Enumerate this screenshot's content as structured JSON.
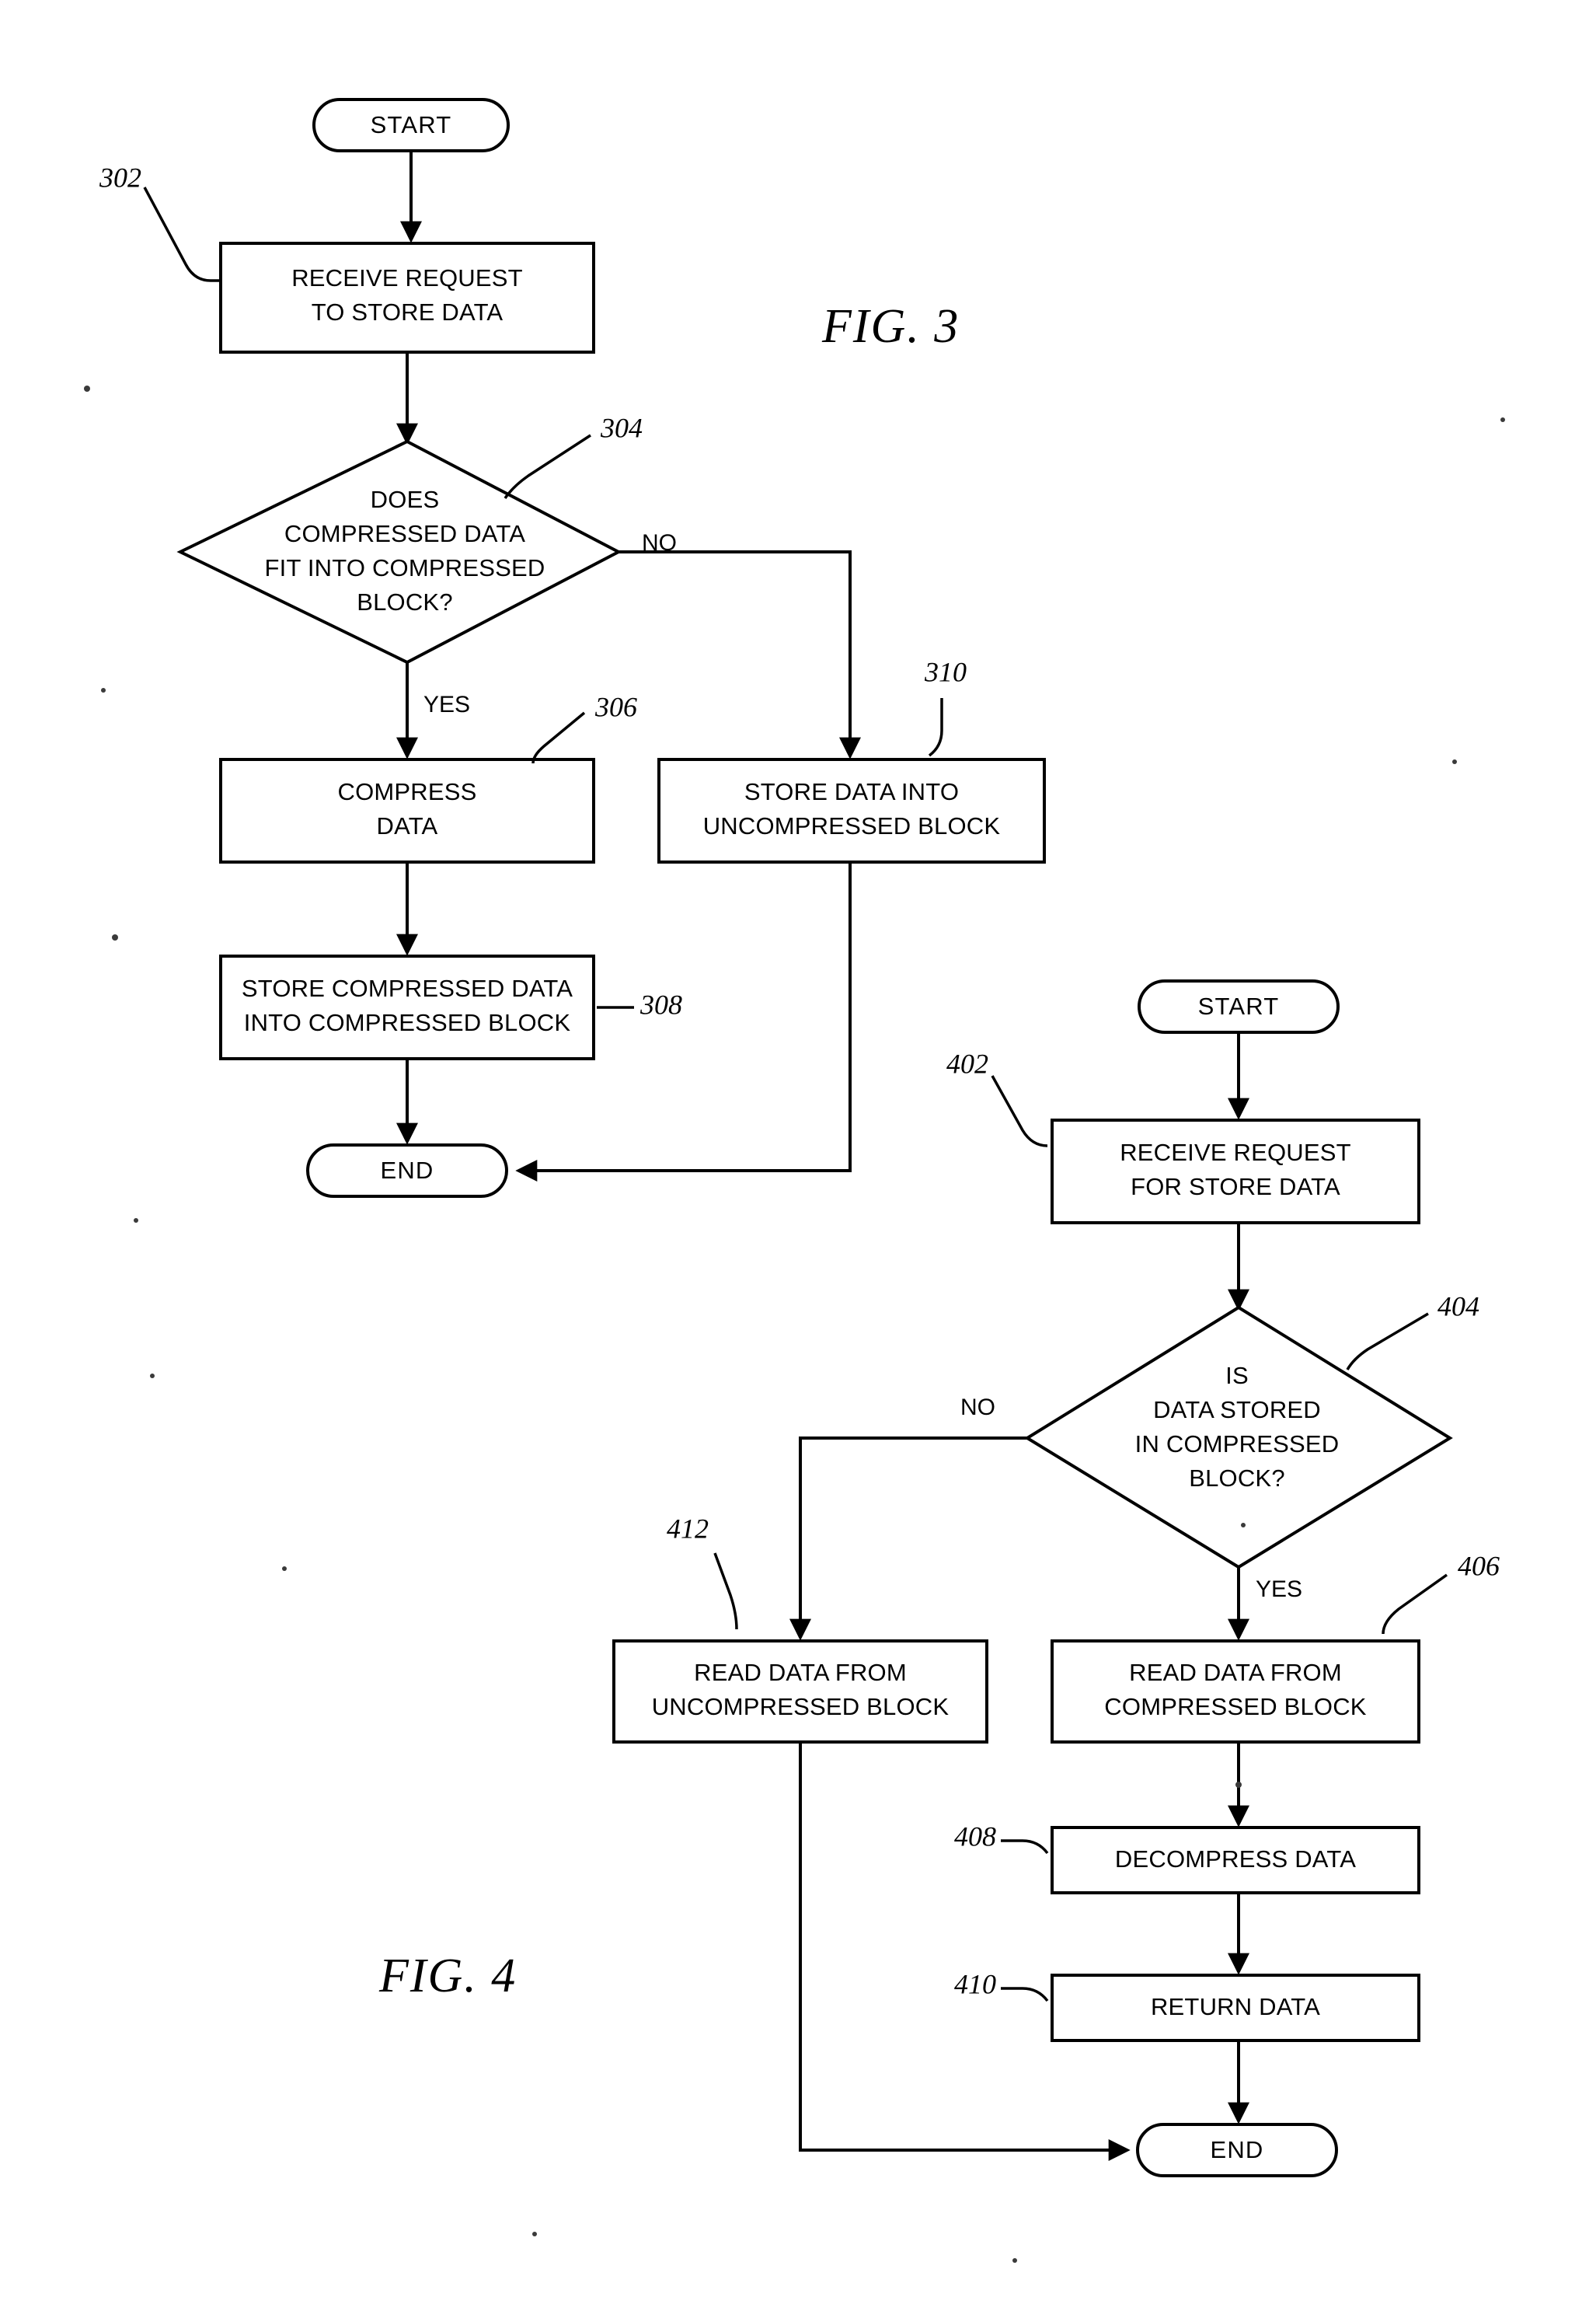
{
  "document": {
    "type": "patent-flowchart-page",
    "figures": [
      {
        "id": "fig3",
        "caption": "FIG.   3",
        "nodes": [
          {
            "id": "fig3-start",
            "shape": "terminator",
            "label": "START"
          },
          {
            "id": "fig3-302",
            "shape": "process",
            "ref": "302",
            "label": [
              "RECEIVE REQUEST",
              "TO STORE DATA"
            ]
          },
          {
            "id": "fig3-304",
            "shape": "decision",
            "ref": "304",
            "label": [
              "DOES",
              "COMPRESSED DATA",
              "FIT INTO COMPRESSED",
              "BLOCK?"
            ]
          },
          {
            "id": "fig3-306",
            "shape": "process",
            "ref": "306",
            "label": [
              "COMPRESS",
              "DATA"
            ]
          },
          {
            "id": "fig3-310",
            "shape": "process",
            "ref": "310",
            "label": [
              "STORE DATA INTO",
              "UNCOMPRESSED BLOCK"
            ]
          },
          {
            "id": "fig3-308",
            "shape": "process",
            "ref": "308",
            "label": [
              "STORE COMPRESSED DATA",
              "INTO COMPRESSED BLOCK"
            ]
          },
          {
            "id": "fig3-end",
            "shape": "terminator",
            "label": "END"
          }
        ],
        "branch_labels": [
          {
            "id": "fig3-no",
            "text": "NO"
          },
          {
            "id": "fig3-yes",
            "text": "YES"
          }
        ]
      },
      {
        "id": "fig4",
        "caption": "FIG.   4",
        "nodes": [
          {
            "id": "fig4-start",
            "shape": "terminator",
            "label": "START"
          },
          {
            "id": "fig4-402",
            "shape": "process",
            "ref": "402",
            "label": [
              "RECEIVE REQUEST",
              "FOR STORE DATA"
            ]
          },
          {
            "id": "fig4-404",
            "shape": "decision",
            "ref": "404",
            "label": [
              "IS",
              "DATA STORED",
              "IN COMPRESSED",
              "BLOCK?"
            ]
          },
          {
            "id": "fig4-412",
            "shape": "process",
            "ref": "412",
            "label": [
              "READ DATA FROM",
              "UNCOMPRESSED BLOCK"
            ]
          },
          {
            "id": "fig4-406",
            "shape": "process",
            "ref": "406",
            "label": [
              "READ DATA FROM",
              "COMPRESSED BLOCK"
            ]
          },
          {
            "id": "fig4-408",
            "shape": "process",
            "ref": "408",
            "label": [
              "DECOMPRESS DATA"
            ]
          },
          {
            "id": "fig4-410",
            "shape": "process",
            "ref": "410",
            "label": [
              "RETURN DATA"
            ]
          },
          {
            "id": "fig4-end",
            "shape": "terminator",
            "label": "END"
          }
        ],
        "branch_labels": [
          {
            "id": "fig4-no",
            "text": "NO"
          },
          {
            "id": "fig4-yes",
            "text": "YES"
          }
        ]
      }
    ]
  },
  "colors": {
    "ink": "#000000",
    "paper": "#ffffff"
  }
}
